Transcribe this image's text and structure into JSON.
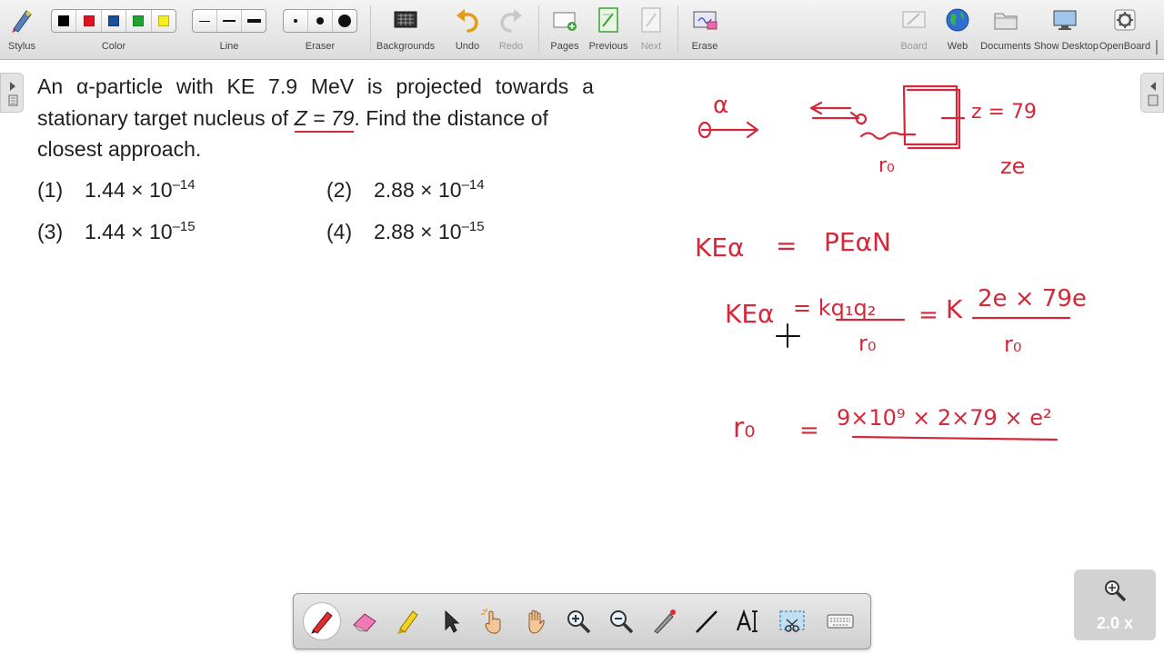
{
  "toolbar": {
    "stylus": "Stylus",
    "color": "Color",
    "line": "Line",
    "eraser": "Eraser",
    "backgrounds": "Backgrounds",
    "undo": "Undo",
    "redo": "Redo",
    "pages": "Pages",
    "previous": "Previous",
    "next": "Next",
    "erase": "Erase",
    "board": "Board",
    "web": "Web",
    "documents": "Documents",
    "show_desktop": "Show Desktop",
    "openboard": "OpenBoard",
    "palette_colors": [
      "#000000",
      "#e0141e",
      "#1b4e9b",
      "#1ea52d",
      "#f7ee1e"
    ]
  },
  "question": {
    "line1_words": [
      "An",
      "α-particle",
      "with",
      "KE",
      "7.9",
      "MeV",
      "is",
      "projected",
      "towards",
      "a"
    ],
    "line2_before": "stationary target nucleus of ",
    "line2_z": "Z = 79",
    "line2_after": ". Find the distance of",
    "line3": "closest approach.",
    "options": [
      {
        "num": "(1)",
        "mantissa": "1.44 × 10",
        "exp": "–14"
      },
      {
        "num": "(2)",
        "mantissa": "2.88 × 10",
        "exp": "–14"
      },
      {
        "num": "(3)",
        "mantissa": "1.44 × 10",
        "exp": "–15"
      },
      {
        "num": "(4)",
        "mantissa": "2.88 × 10",
        "exp": "–15"
      }
    ]
  },
  "handwriting": {
    "alpha": "α",
    "z_eq": "z = 79",
    "r0": "r₀",
    "ze": "ze",
    "eq1_left": "KEα",
    "eq1_eq": "=",
    "eq1_right": "PEαN",
    "eq2_left": "KEα",
    "eq2_mid": "= kq₁q₂",
    "eq2_den": "r₀",
    "eq2_eq": "=",
    "eq2_k": "K",
    "eq2_num": "2e × 79e",
    "eq2_den2": "r₀",
    "eq3_left": "r₀",
    "eq3_eq": "=",
    "eq3_num": "9×10⁹ × 2×79 × e²",
    "ink_color": "#d3283a"
  },
  "zoom": {
    "label": "2.0 x"
  }
}
